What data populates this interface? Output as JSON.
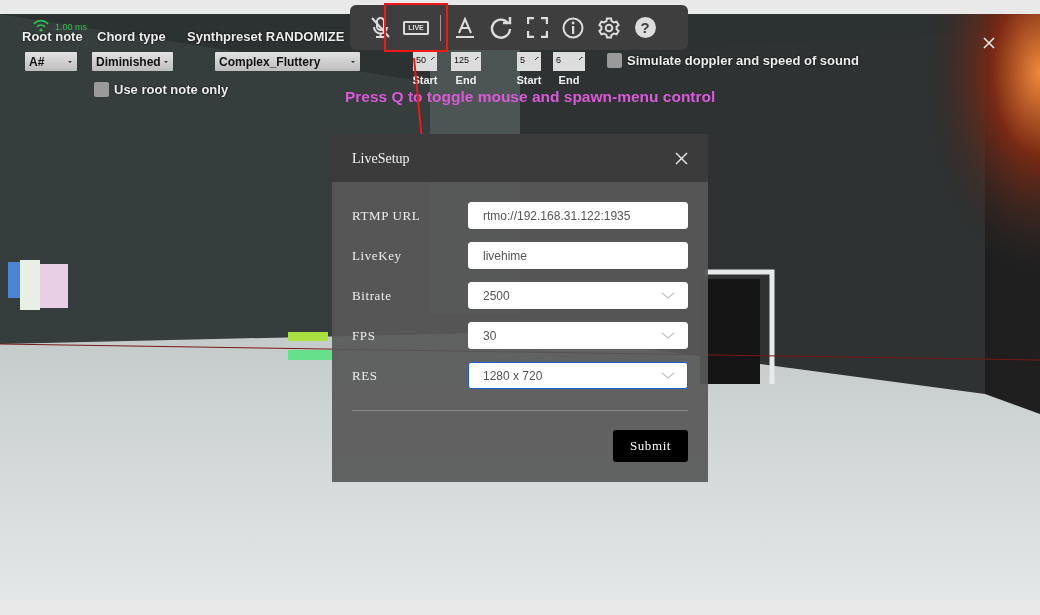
{
  "stream_overlay": {
    "latency": "1.00 ms",
    "selectors": [
      {
        "label": "Root note",
        "value": "A#"
      },
      {
        "label": "Chord type",
        "value": "Diminished"
      },
      {
        "label": "Synthpreset RANDOMIZE",
        "value": "Complex_Fluttery"
      }
    ],
    "ranges": [
      {
        "start": "50",
        "end": "125",
        "start_caption": "Start",
        "end_caption": "End"
      },
      {
        "start": "5",
        "end": "6",
        "start_caption": "Start",
        "end_caption": "End"
      }
    ],
    "checkboxes": [
      {
        "label": "Use root note only",
        "checked": false
      },
      {
        "label": "Simulate doppler and speed of sound",
        "checked": false
      }
    ],
    "hint": "Press Q to toggle mouse and spawn-menu control"
  },
  "toolbar": [
    {
      "kind": "mic-off",
      "highlighted": false
    },
    {
      "kind": "live",
      "label": "LIVE",
      "highlighted": true
    },
    {
      "kind": "divider"
    },
    {
      "kind": "text-color",
      "highlighted": false
    },
    {
      "kind": "refresh",
      "highlighted": false
    },
    {
      "kind": "fullscreen",
      "highlighted": false
    },
    {
      "kind": "info",
      "highlighted": false
    },
    {
      "kind": "settings",
      "highlighted": false
    },
    {
      "kind": "help",
      "label": "?",
      "highlighted": false
    }
  ],
  "live_setup": {
    "title": "LiveSetup",
    "fields": [
      {
        "label": "RTMP URL",
        "kind": "text",
        "value": "rtmo://192.168.31.122:1935",
        "focused": false
      },
      {
        "label": "LiveKey",
        "kind": "text",
        "value": "livehime",
        "focused": false
      },
      {
        "label": "Bitrate",
        "kind": "select",
        "value": "2500",
        "focused": false
      },
      {
        "label": "FPS",
        "kind": "select",
        "value": "30",
        "focused": false
      },
      {
        "label": "RES",
        "kind": "select",
        "value": "1280 x 720",
        "focused": true
      }
    ],
    "submit": "Submit"
  }
}
